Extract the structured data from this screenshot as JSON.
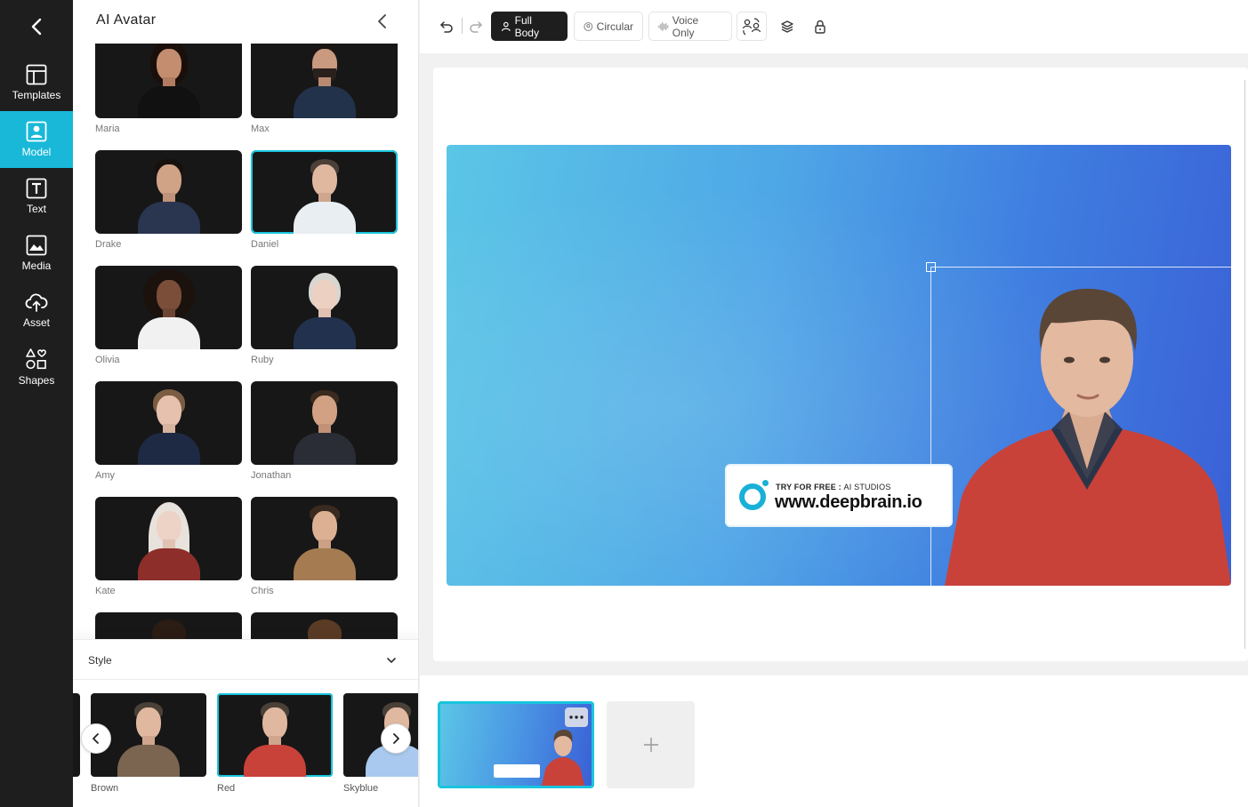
{
  "rail": {
    "items": [
      {
        "label": "Templates",
        "icon": "layout-icon"
      },
      {
        "label": "Model",
        "icon": "person-icon"
      },
      {
        "label": "Text",
        "icon": "text-icon"
      },
      {
        "label": "Media",
        "icon": "image-icon"
      },
      {
        "label": "Asset",
        "icon": "cloud-upload-icon"
      },
      {
        "label": "Shapes",
        "icon": "shapes-icon"
      }
    ],
    "active": "Model"
  },
  "panel": {
    "title": "AI Avatar",
    "avatars": [
      {
        "name": "Maria"
      },
      {
        "name": "Max"
      },
      {
        "name": "Drake"
      },
      {
        "name": "Daniel"
      },
      {
        "name": "Olivia"
      },
      {
        "name": "Ruby"
      },
      {
        "name": "Amy"
      },
      {
        "name": "Jonathan"
      },
      {
        "name": "Kate"
      },
      {
        "name": "Chris"
      }
    ],
    "selected_avatar": "Daniel"
  },
  "style": {
    "label": "Style",
    "options": [
      {
        "name": "Brown"
      },
      {
        "name": "Red"
      },
      {
        "name": "Skyblue"
      }
    ],
    "selected": "Red"
  },
  "toolbar": {
    "full_body": "Full Body",
    "circular": "Circular",
    "voice_only": "Voice Only",
    "active": "Full Body"
  },
  "scene": {
    "logo_try": "TRY FOR FREE :",
    "logo_try_light": "AI STUDIOS",
    "logo_url": "www.deepbrain.io"
  },
  "colors": {
    "accent": "#19b8d8",
    "rail_bg": "#1e1e1e",
    "sweater": "#c8423a"
  }
}
